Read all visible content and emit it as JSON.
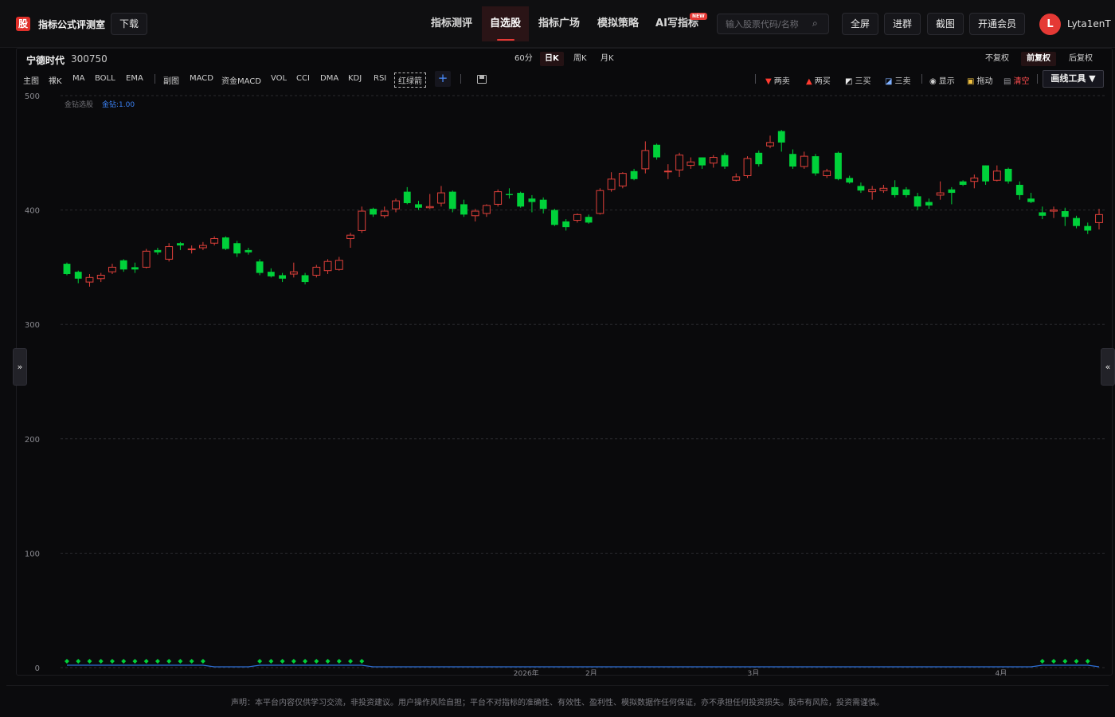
{
  "header": {
    "logo_char": "股",
    "brand": "指标公式评测室",
    "download": "下载",
    "nav": [
      {
        "label": "指标测评",
        "active": false
      },
      {
        "label": "自选股",
        "active": true
      },
      {
        "label": "指标广场",
        "active": false
      },
      {
        "label": "模拟策略",
        "active": false
      },
      {
        "label": "AI写指标",
        "active": false
      }
    ],
    "new_badge": "NEW",
    "search_placeholder": "输入股票代码/名称",
    "search_icon": "⌕",
    "buttons": [
      "全屏",
      "进群",
      "截图",
      "开通会员"
    ],
    "avatar_letter": "L",
    "username": "Lyta1enT"
  },
  "stock": {
    "name": "宁德时代",
    "code": "300750"
  },
  "periods": [
    {
      "label": "60分",
      "active": false
    },
    {
      "label": "日K",
      "active": true
    },
    {
      "label": "周K",
      "active": false
    },
    {
      "label": "月K",
      "active": false
    }
  ],
  "adjust": [
    {
      "label": "不复权",
      "active": false
    },
    {
      "label": "前复权",
      "active": true
    },
    {
      "label": "后复权",
      "active": false
    }
  ],
  "indicators": {
    "main_label": "主图",
    "main": [
      "裸K",
      "MA",
      "BOLL",
      "EMA"
    ],
    "sub_label": "副图",
    "sub": [
      "MACD",
      "资金MACD",
      "VOL",
      "CCI",
      "DMA",
      "KDJ",
      "RSI"
    ],
    "custom": "红绿箭",
    "add": "+"
  },
  "tools": {
    "two_sell": "两卖",
    "two_buy": "两买",
    "three_buy": "三买",
    "three_sell": "三卖",
    "show": "显示",
    "drag": "拖动",
    "clear": "清空",
    "draw": "画线工具 ▼",
    "colors": {
      "sell": "#ff3b30",
      "buy": "#ff3b30",
      "clear": "#ff4d4f"
    }
  },
  "legend": {
    "title": "金钻选股",
    "value": "金钻:1.00"
  },
  "side": {
    "left": "»",
    "right": "«"
  },
  "footer": "声明：本平台内容仅供学习交流，非投资建议。用户操作风险自担；平台不对指标的准确性、有效性、盈利性、模拟数据作任何保证，亦不承担任何投资损失。股市有风险，投资需谨慎。",
  "chart_data": {
    "type": "candlestick",
    "ylim": [
      0,
      500
    ],
    "y_ticks": [
      0,
      100,
      200,
      300,
      400,
      500
    ],
    "x_tick_labels": [
      "2026年",
      "2月",
      "3月",
      "4月"
    ],
    "colors": {
      "up": "#e0403a",
      "down": "#00d13a",
      "signal": "#00d13a",
      "baseline": "#2d6fd6",
      "grid": "#2a2a2e"
    },
    "candles": [
      {
        "o": 353,
        "h": 354,
        "l": 343,
        "c": 344
      },
      {
        "o": 346,
        "h": 347,
        "l": 336,
        "c": 340
      },
      {
        "o": 337,
        "h": 344,
        "l": 333,
        "c": 341
      },
      {
        "o": 340,
        "h": 345,
        "l": 337,
        "c": 343
      },
      {
        "o": 346,
        "h": 353,
        "l": 344,
        "c": 350
      },
      {
        "o": 356,
        "h": 357,
        "l": 346,
        "c": 348
      },
      {
        "o": 350,
        "h": 354,
        "l": 345,
        "c": 348
      },
      {
        "o": 350,
        "h": 366,
        "l": 349,
        "c": 364
      },
      {
        "o": 365,
        "h": 367,
        "l": 361,
        "c": 363
      },
      {
        "o": 357,
        "h": 371,
        "l": 355,
        "c": 368
      },
      {
        "o": 371,
        "h": 372,
        "l": 365,
        "c": 369
      },
      {
        "o": 366,
        "h": 369,
        "l": 362,
        "c": 366
      },
      {
        "o": 367,
        "h": 372,
        "l": 365,
        "c": 369
      },
      {
        "o": 371,
        "h": 377,
        "l": 369,
        "c": 375
      },
      {
        "o": 376,
        "h": 377,
        "l": 365,
        "c": 366
      },
      {
        "o": 371,
        "h": 373,
        "l": 359,
        "c": 362
      },
      {
        "o": 365,
        "h": 367,
        "l": 361,
        "c": 363
      },
      {
        "o": 355,
        "h": 357,
        "l": 343,
        "c": 345
      },
      {
        "o": 346,
        "h": 349,
        "l": 341,
        "c": 342
      },
      {
        "o": 343,
        "h": 345,
        "l": 337,
        "c": 340
      },
      {
        "o": 344,
        "h": 354,
        "l": 341,
        "c": 346
      },
      {
        "o": 343,
        "h": 345,
        "l": 335,
        "c": 337
      },
      {
        "o": 343,
        "h": 352,
        "l": 341,
        "c": 350
      },
      {
        "o": 347,
        "h": 357,
        "l": 344,
        "c": 355
      },
      {
        "o": 348,
        "h": 359,
        "l": 347,
        "c": 356
      },
      {
        "o": 375,
        "h": 380,
        "l": 367,
        "c": 378
      },
      {
        "o": 382,
        "h": 403,
        "l": 380,
        "c": 399
      },
      {
        "o": 401,
        "h": 402,
        "l": 394,
        "c": 396
      },
      {
        "o": 395,
        "h": 403,
        "l": 393,
        "c": 399
      },
      {
        "o": 401,
        "h": 410,
        "l": 398,
        "c": 408
      },
      {
        "o": 416,
        "h": 420,
        "l": 405,
        "c": 406
      },
      {
        "o": 405,
        "h": 408,
        "l": 400,
        "c": 402
      },
      {
        "o": 402,
        "h": 414,
        "l": 401,
        "c": 403
      },
      {
        "o": 406,
        "h": 421,
        "l": 403,
        "c": 415
      },
      {
        "o": 416,
        "h": 417,
        "l": 398,
        "c": 401
      },
      {
        "o": 405,
        "h": 409,
        "l": 394,
        "c": 396
      },
      {
        "o": 395,
        "h": 401,
        "l": 390,
        "c": 399
      },
      {
        "o": 397,
        "h": 405,
        "l": 394,
        "c": 404
      },
      {
        "o": 405,
        "h": 418,
        "l": 403,
        "c": 416
      },
      {
        "o": 414,
        "h": 419,
        "l": 410,
        "c": 413
      },
      {
        "o": 415,
        "h": 416,
        "l": 402,
        "c": 403
      },
      {
        "o": 410,
        "h": 413,
        "l": 398,
        "c": 407
      },
      {
        "o": 409,
        "h": 411,
        "l": 397,
        "c": 401
      },
      {
        "o": 400,
        "h": 401,
        "l": 386,
        "c": 387
      },
      {
        "o": 390,
        "h": 392,
        "l": 382,
        "c": 385
      },
      {
        "o": 391,
        "h": 397,
        "l": 389,
        "c": 396
      },
      {
        "o": 394,
        "h": 396,
        "l": 388,
        "c": 389
      },
      {
        "o": 397,
        "h": 419,
        "l": 396,
        "c": 417
      },
      {
        "o": 418,
        "h": 433,
        "l": 416,
        "c": 427
      },
      {
        "o": 421,
        "h": 433,
        "l": 419,
        "c": 432
      },
      {
        "o": 434,
        "h": 436,
        "l": 426,
        "c": 427
      },
      {
        "o": 436,
        "h": 460,
        "l": 432,
        "c": 452
      },
      {
        "o": 457,
        "h": 458,
        "l": 444,
        "c": 446
      },
      {
        "o": 434,
        "h": 440,
        "l": 427,
        "c": 434
      },
      {
        "o": 435,
        "h": 450,
        "l": 429,
        "c": 448
      },
      {
        "o": 439,
        "h": 446,
        "l": 436,
        "c": 442
      },
      {
        "o": 446,
        "h": 446,
        "l": 436,
        "c": 439
      },
      {
        "o": 441,
        "h": 448,
        "l": 437,
        "c": 446
      },
      {
        "o": 448,
        "h": 450,
        "l": 436,
        "c": 438
      },
      {
        "o": 426,
        "h": 432,
        "l": 425,
        "c": 429
      },
      {
        "o": 430,
        "h": 447,
        "l": 428,
        "c": 445
      },
      {
        "o": 450,
        "h": 452,
        "l": 438,
        "c": 440
      },
      {
        "o": 456,
        "h": 465,
        "l": 454,
        "c": 459
      },
      {
        "o": 469,
        "h": 470,
        "l": 451,
        "c": 459
      },
      {
        "o": 449,
        "h": 453,
        "l": 436,
        "c": 438
      },
      {
        "o": 438,
        "h": 451,
        "l": 436,
        "c": 447
      },
      {
        "o": 447,
        "h": 449,
        "l": 430,
        "c": 432
      },
      {
        "o": 430,
        "h": 436,
        "l": 428,
        "c": 434
      },
      {
        "o": 450,
        "h": 451,
        "l": 426,
        "c": 427
      },
      {
        "o": 428,
        "h": 430,
        "l": 423,
        "c": 424
      },
      {
        "o": 421,
        "h": 424,
        "l": 415,
        "c": 417
      },
      {
        "o": 416,
        "h": 421,
        "l": 409,
        "c": 418
      },
      {
        "o": 417,
        "h": 422,
        "l": 415,
        "c": 419
      },
      {
        "o": 420,
        "h": 426,
        "l": 411,
        "c": 413
      },
      {
        "o": 418,
        "h": 420,
        "l": 411,
        "c": 413
      },
      {
        "o": 412,
        "h": 415,
        "l": 400,
        "c": 403
      },
      {
        "o": 407,
        "h": 410,
        "l": 401,
        "c": 404
      },
      {
        "o": 413,
        "h": 425,
        "l": 409,
        "c": 415
      },
      {
        "o": 418,
        "h": 420,
        "l": 405,
        "c": 415
      },
      {
        "o": 425,
        "h": 426,
        "l": 421,
        "c": 422
      },
      {
        "o": 425,
        "h": 431,
        "l": 419,
        "c": 428
      },
      {
        "o": 439,
        "h": 439,
        "l": 422,
        "c": 425
      },
      {
        "o": 426,
        "h": 439,
        "l": 425,
        "c": 434
      },
      {
        "o": 436,
        "h": 437,
        "l": 423,
        "c": 425
      },
      {
        "o": 422,
        "h": 425,
        "l": 409,
        "c": 413
      },
      {
        "o": 410,
        "h": 415,
        "l": 406,
        "c": 407
      },
      {
        "o": 398,
        "h": 403,
        "l": 392,
        "c": 395
      },
      {
        "o": 399,
        "h": 403,
        "l": 393,
        "c": 400
      },
      {
        "o": 399,
        "h": 402,
        "l": 386,
        "c": 394
      },
      {
        "o": 393,
        "h": 395,
        "l": 384,
        "c": 386
      },
      {
        "o": 386,
        "h": 389,
        "l": 379,
        "c": 382
      },
      {
        "o": 389,
        "h": 401,
        "l": 383,
        "c": 396
      }
    ],
    "signal_groups": [
      [
        0,
        12
      ],
      [
        17,
        26
      ],
      [
        86,
        90
      ]
    ],
    "signal_value": 1
  }
}
